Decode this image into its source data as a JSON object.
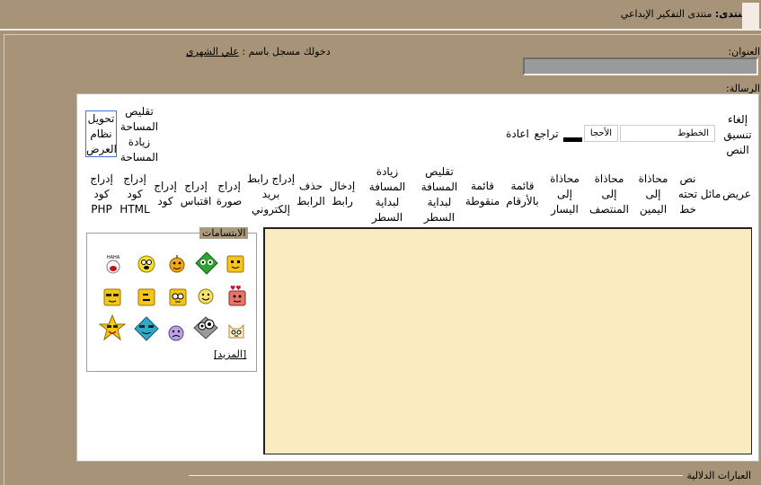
{
  "header": {
    "forum_label": "المنتدى:",
    "forum_name": "منتدى التفكير الإبداعي"
  },
  "login": {
    "prefix": "دخولك مسجل باسم :",
    "username": "علي الشهري"
  },
  "form": {
    "title_label": "العنوان:",
    "message_label": "الرسالة:",
    "keywords_label": "العبارات الدلالية"
  },
  "toolbar": {
    "remove_format": "إلغاء تنسيق النص",
    "font_select": "الخطوط",
    "size_select": "الأحجا",
    "undo": "تراجع",
    "redo": "اعادة",
    "shrink_area": "تقليص المساحة",
    "grow_area": "زيادة المساحة",
    "convert_mode": "تحويل نظام العرض",
    "bold": "عريض",
    "italic": "مائل",
    "underline": "نص تحته خط",
    "align_right": "محاذاة إلى اليمين",
    "align_center": "محاذاة إلى المنتصف",
    "align_left": "محاذاة إلى اليسار",
    "ordered_list": "قائمة بالأرقام",
    "bullet_list": "قائمة منقوطة",
    "outdent": "تقليص المسافة لبداية السطر",
    "indent": "زيادة المسافة لبداية السطر",
    "insert_link": "إدخال رابط",
    "remove_link": "حذف الرابط",
    "insert_email": "إدراج رابط بريد إلكتروني",
    "insert_image": "إدراج صورة",
    "insert_quote": "إدراج اقتباس",
    "insert_code": "إدراج كود",
    "insert_html": "إدراج كود HTML",
    "insert_php": "إدراج كود PHP"
  },
  "smilies": {
    "legend": "الابتسامات",
    "more": "[المزيد]",
    "icons": [
      "square-smile-icon",
      "green-diamond-face-icon",
      "orange-wink-face-icon",
      "dizzy-face-icon",
      "hahaha-face-icon",
      "love-face-icon",
      "grin-face-icon",
      "glasses-square-icon",
      "flat-mouth-square-icon",
      "cool-square-icon",
      "cat-face-icon",
      "grey-diamond-face-icon",
      "purple-sad-face-icon",
      "blue-diamond-face-icon",
      "star-face-icon"
    ]
  }
}
